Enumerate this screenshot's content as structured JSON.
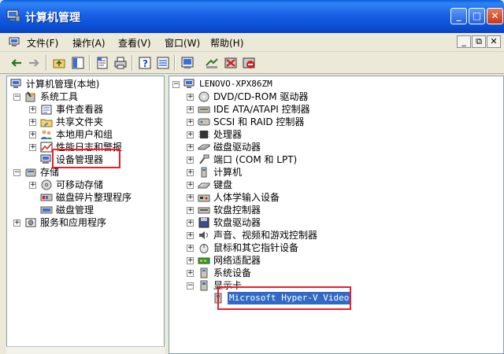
{
  "window": {
    "title": "计算机管理",
    "buttons": {
      "minimize": "_",
      "maximize": "□",
      "close": "✕"
    }
  },
  "menubar": {
    "items": [
      {
        "label": "文件(F)"
      },
      {
        "label": "操作(A)"
      },
      {
        "label": "查看(V)"
      },
      {
        "label": "窗口(W)"
      },
      {
        "label": "帮助(H)"
      }
    ],
    "inner_buttons": {
      "minimize": "_",
      "restore": "⧉",
      "close": "✕"
    }
  },
  "left_tree": {
    "root": "计算机管理(本地)",
    "nodes": [
      {
        "label": "系统工具"
      },
      {
        "label": "事件查看器"
      },
      {
        "label": "共享文件夹"
      },
      {
        "label": "本地用户和组"
      },
      {
        "label": "性能日志和警报"
      },
      {
        "label": "设备管理器"
      },
      {
        "label": "存储"
      },
      {
        "label": "可移动存储"
      },
      {
        "label": "磁盘碎片整理程序"
      },
      {
        "label": "磁盘管理"
      },
      {
        "label": "服务和应用程序"
      }
    ]
  },
  "right_tree": {
    "root": "LENOVO-XPX86ZM",
    "nodes": [
      {
        "label": "DVD/CD-ROM 驱动器"
      },
      {
        "label": "IDE ATA/ATAPI 控制器"
      },
      {
        "label": "SCSI 和 RAID 控制器"
      },
      {
        "label": "处理器"
      },
      {
        "label": "磁盘驱动器"
      },
      {
        "label": "端口 (COM 和 LPT)"
      },
      {
        "label": "计算机"
      },
      {
        "label": "键盘"
      },
      {
        "label": "人体学输入设备"
      },
      {
        "label": "软盘控制器"
      },
      {
        "label": "软盘驱动器"
      },
      {
        "label": "声音、视频和游戏控制器"
      },
      {
        "label": "鼠标和其它指针设备"
      },
      {
        "label": "网络适配器"
      },
      {
        "label": "系统设备"
      },
      {
        "label": "显示卡"
      }
    ],
    "display_child": "Microsoft Hyper-V Video"
  },
  "colors": {
    "title_blue": "#0b4fd4",
    "highlight_red": "#e8202a",
    "selection_blue": "#316ac5"
  }
}
